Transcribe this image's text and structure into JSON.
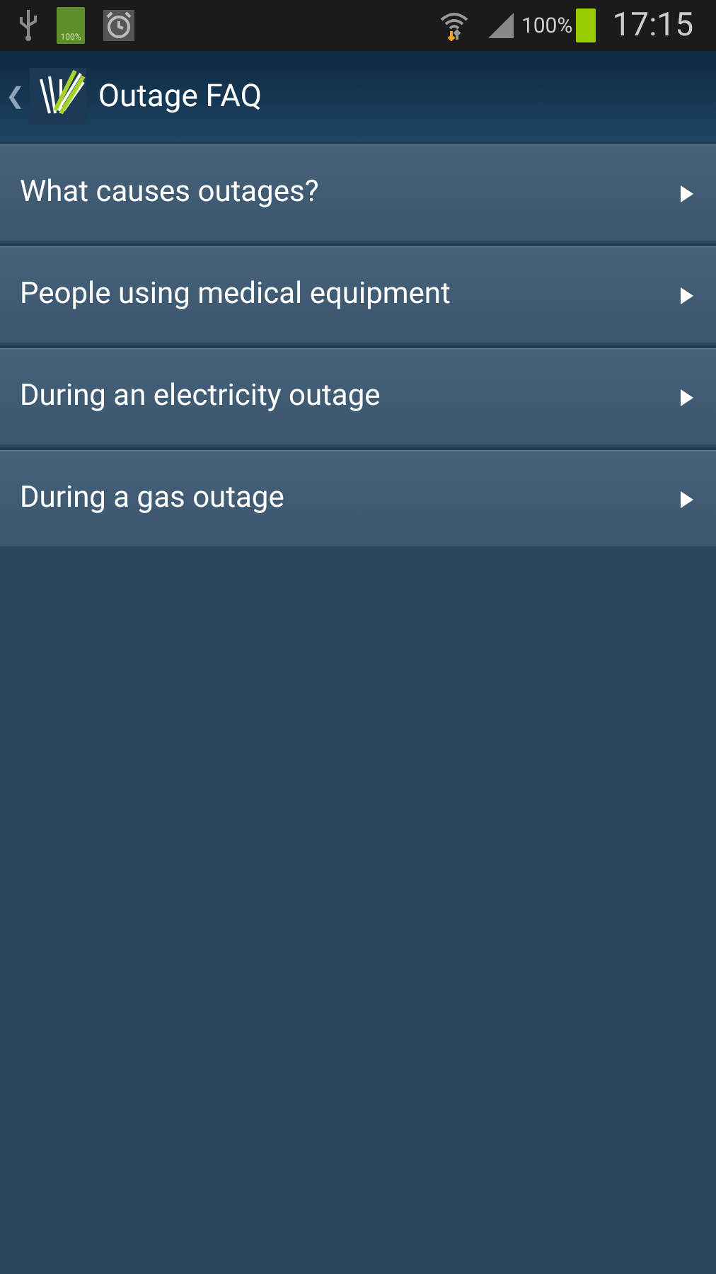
{
  "status_bar": {
    "battery_notification_text": "100%",
    "battery_percent": "100%",
    "time": "17:15"
  },
  "action_bar": {
    "back": "❮",
    "title": "Outage FAQ"
  },
  "faq_items": [
    {
      "label": "What causes outages?"
    },
    {
      "label": "People using medical equipment"
    },
    {
      "label": "During an electricity outage"
    },
    {
      "label": "During a gas outage"
    }
  ]
}
